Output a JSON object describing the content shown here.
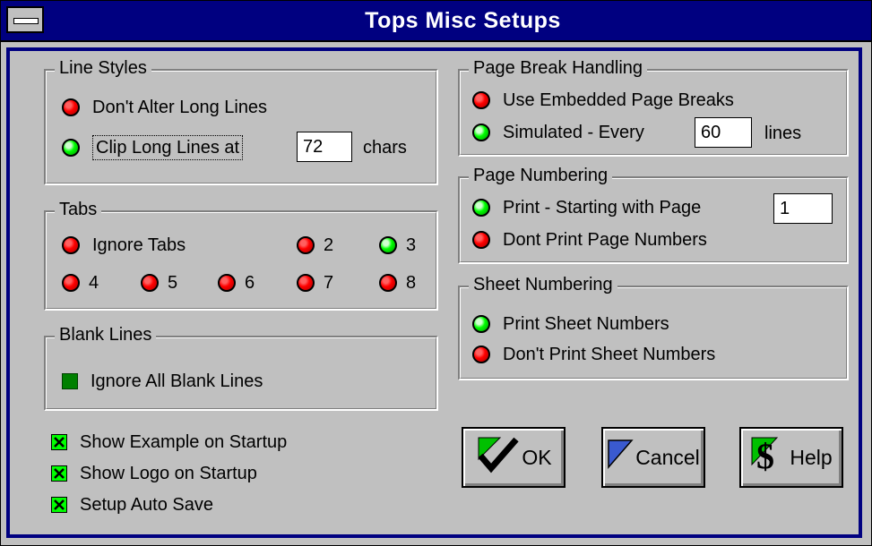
{
  "window": {
    "title": "Tops Misc Setups"
  },
  "line_styles": {
    "legend": "Line Styles",
    "options": [
      {
        "label": "Don't Alter Long Lines",
        "state": "off"
      },
      {
        "label": "Clip Long Lines at",
        "state": "on"
      }
    ],
    "clip_value": "72",
    "clip_unit": "chars"
  },
  "tabs": {
    "legend": "Tabs",
    "options": [
      {
        "label": "Ignore Tabs",
        "state": "off"
      },
      {
        "label": "2",
        "state": "off"
      },
      {
        "label": "3",
        "state": "on"
      },
      {
        "label": "4",
        "state": "off"
      },
      {
        "label": "5",
        "state": "off"
      },
      {
        "label": "6",
        "state": "off"
      },
      {
        "label": "7",
        "state": "off"
      },
      {
        "label": "8",
        "state": "off"
      }
    ]
  },
  "blank_lines": {
    "legend": "Blank Lines",
    "option": {
      "label": "Ignore All Blank Lines",
      "checked": false
    }
  },
  "startup": [
    {
      "label": "Show Example on Startup",
      "checked": true
    },
    {
      "label": "Show Logo on Startup",
      "checked": true
    },
    {
      "label": "Setup Auto Save",
      "checked": true
    }
  ],
  "page_break": {
    "legend": "Page Break Handling",
    "options": [
      {
        "label": "Use Embedded Page Breaks",
        "state": "off"
      },
      {
        "label": "Simulated - Every",
        "state": "on"
      }
    ],
    "every_value": "60",
    "every_unit": "lines"
  },
  "page_numbering": {
    "legend": "Page Numbering",
    "options": [
      {
        "label": "Print - Starting with Page",
        "state": "on"
      },
      {
        "label": "Dont Print Page Numbers",
        "state": "off"
      }
    ],
    "start_value": "1"
  },
  "sheet_numbering": {
    "legend": "Sheet Numbering",
    "options": [
      {
        "label": "Print Sheet Numbers",
        "state": "on"
      },
      {
        "label": "Don't Print Sheet Numbers",
        "state": "off"
      }
    ]
  },
  "buttons": {
    "ok": "OK",
    "cancel": "Cancel",
    "help": "Help"
  },
  "colors": {
    "title_bar": "#000080",
    "led_on": "#00ff00",
    "led_off": "#ff0000",
    "face": "#c0c0c0"
  }
}
